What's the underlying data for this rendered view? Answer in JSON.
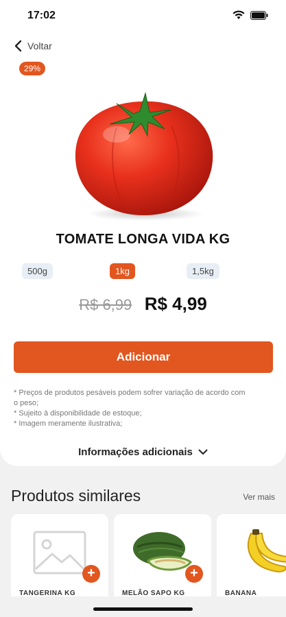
{
  "status_bar": {
    "time": "17:02"
  },
  "nav": {
    "back_label": "Voltar"
  },
  "product": {
    "discount_badge": "29%",
    "name": "TOMATE LONGA VIDA KG",
    "weights": [
      {
        "label": "500g",
        "selected": false
      },
      {
        "label": "1kg",
        "selected": true
      },
      {
        "label": "1,5kg",
        "selected": false
      }
    ],
    "old_price": "R$ 6,99",
    "new_price": "R$ 4,99"
  },
  "actions": {
    "add_label": "Adicionar"
  },
  "notes": [
    "* Preços de produtos pesáveis podem sofrer variação de acordo com o peso;",
    "* Sujeito à disponibilidade de estoque;",
    "* Imagem meramente ilustrativa;"
  ],
  "more_info": {
    "label": "Informações adicionais"
  },
  "similar": {
    "title": "Produtos similares",
    "see_more": "Ver mais",
    "items": [
      {
        "name": "TANGERINA KG"
      },
      {
        "name": "MELÃO SAPO KG"
      },
      {
        "name": "BANANA"
      }
    ]
  },
  "colors": {
    "accent": "#e2561f",
    "chip_bg": "#e8eef5"
  },
  "icons": [
    "wifi-icon",
    "battery-icon",
    "back-chevron-icon",
    "chevron-down-icon",
    "plus-icon",
    "image-placeholder-icon"
  ]
}
